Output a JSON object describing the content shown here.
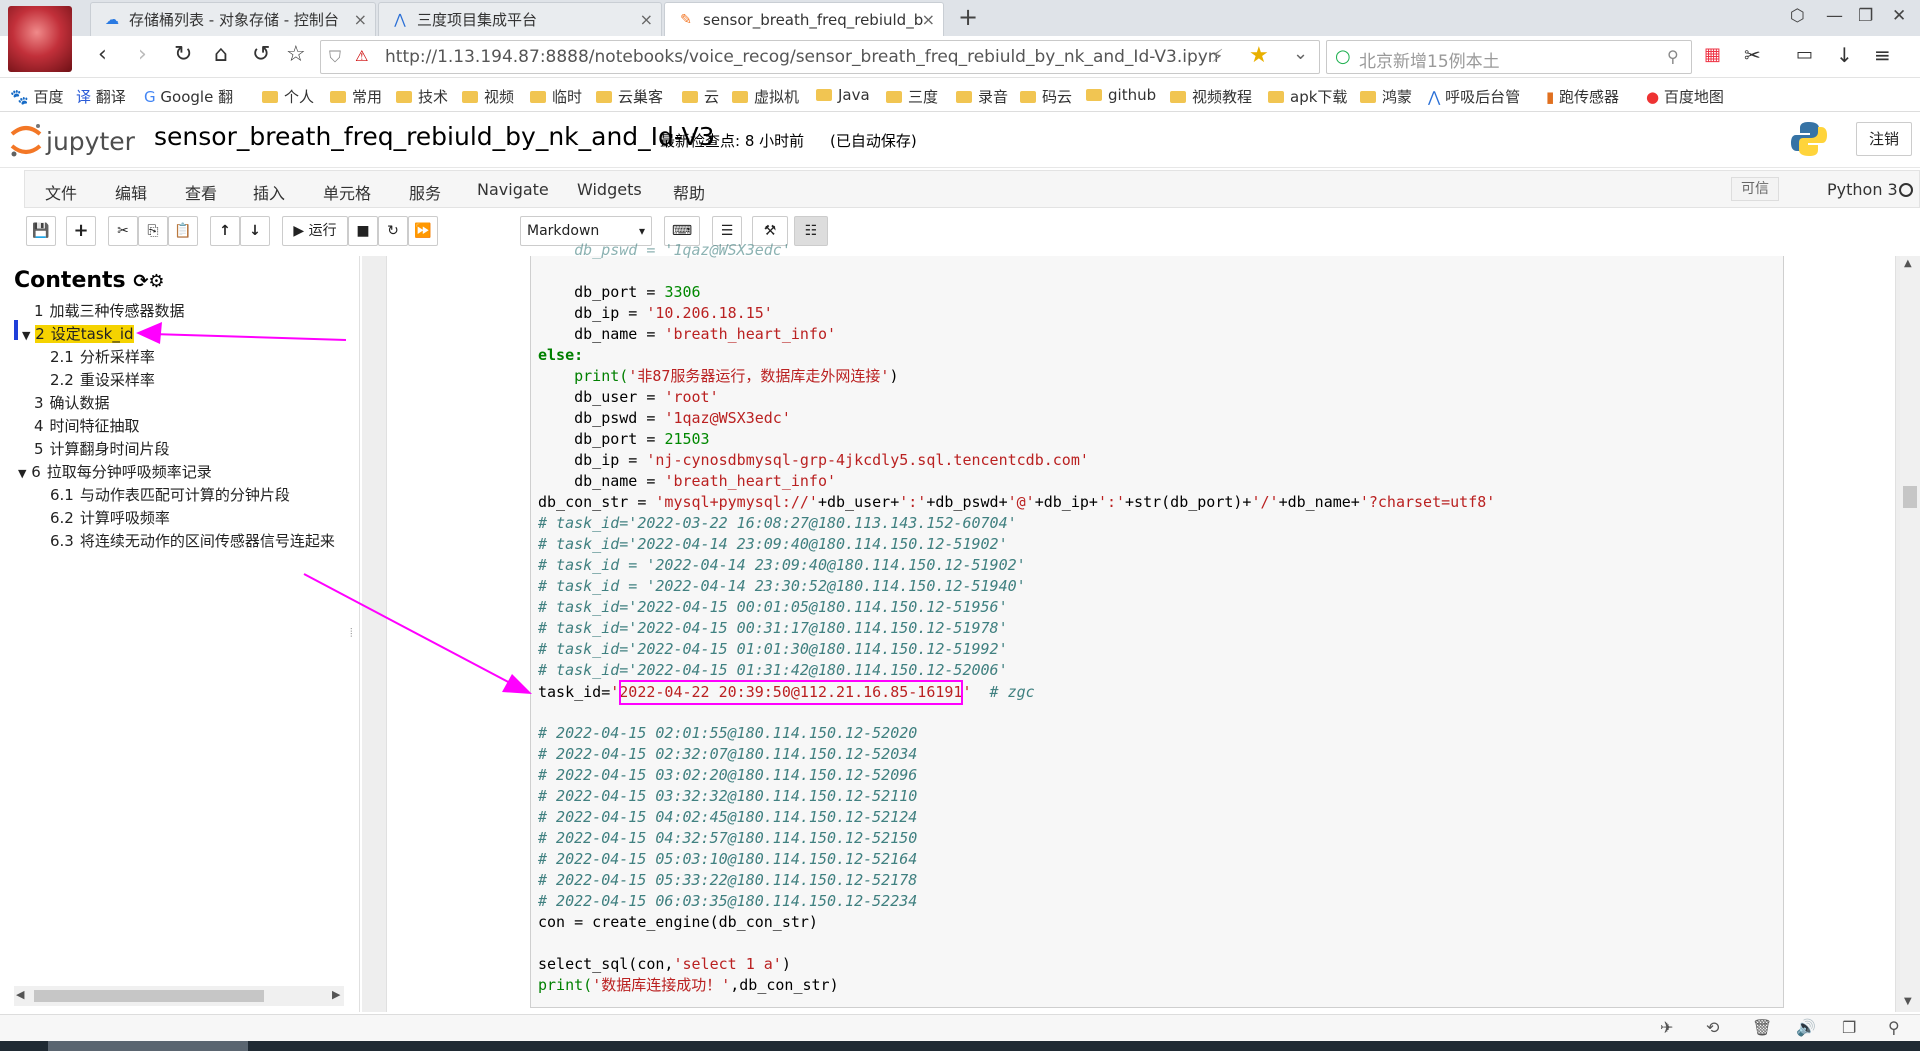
{
  "browser": {
    "tabs": [
      {
        "label": "存储桶列表 - 对象存储 - 控制台",
        "icon": "cloud-icon"
      },
      {
        "label": "三度项目集成平台",
        "icon": "platform-icon"
      },
      {
        "label": "sensor_breath_freq_rebiuld_b",
        "icon": "jupyter-icon"
      }
    ],
    "url": "http://1.13.194.87:8888/notebooks/voice_recog/sensor_breath_freq_rebiuld_by_nk_and_Id-V3.ipyn",
    "search_placeholder": "北京新增15例本土",
    "bookmarks": [
      "百度",
      "翻译",
      "Google 翻",
      "个人",
      "常用",
      "技术",
      "视频",
      "临时",
      "云巢客",
      "云",
      "虚拟机",
      "Java",
      "三度",
      "录音",
      "码云",
      "github",
      "视频教程",
      "apk下载",
      "鸿蒙",
      "呼吸后台管",
      "跑传感器",
      "百度地图"
    ]
  },
  "jupyter": {
    "logo_text": "jupyter",
    "notebook_name": "sensor_breath_freq_rebiuld_by_nk_and_Id-V3",
    "checkpoint": "最新检查点: 8 小时前",
    "autosave": "(已自动保存)",
    "logout": "注销",
    "menu": [
      "文件",
      "编辑",
      "查看",
      "插入",
      "单元格",
      "服务",
      "Navigate",
      "Widgets",
      "帮助"
    ],
    "trusted": "可信",
    "kernel": "Python 3",
    "toolbar": {
      "run": "运行",
      "cell_type": "Markdown"
    }
  },
  "toc": {
    "title": "Contents",
    "items": [
      {
        "num": "1",
        "label": "加载三种传感器数据"
      },
      {
        "num": "2",
        "label": "设定task_id"
      },
      {
        "num": "2.1",
        "label": "分析采样率"
      },
      {
        "num": "2.2",
        "label": "重设采样率"
      },
      {
        "num": "3",
        "label": "确认数据"
      },
      {
        "num": "4",
        "label": "时间特征抽取"
      },
      {
        "num": "5",
        "label": "计算翻身时间片段"
      },
      {
        "num": "6",
        "label": "拉取每分钟呼吸频率记录"
      },
      {
        "num": "6.1",
        "label": "与动作表匹配可计算的分钟片段"
      },
      {
        "num": "6.2",
        "label": "计算呼吸频率"
      },
      {
        "num": "6.3",
        "label": "将连续无动作的区间传感器信号连起来"
      }
    ]
  },
  "code": {
    "l_top": "    db_pswd = '1qaz@WSX3edc'",
    "l1_a": "    db_port = ",
    "l1_b": "3306",
    "l2_a": "    db_ip = ",
    "l2_b": "'10.206.18.15'",
    "l3_a": "    db_name = ",
    "l3_b": "'breath_heart_info'",
    "l4": "else:",
    "l5_a": "    print(",
    "l5_b": "'非87服务器运行，数据库走外网连接'",
    "l5_c": ")",
    "l6_a": "    db_user = ",
    "l6_b": "'root'",
    "l7_a": "    db_pswd = ",
    "l7_b": "'1qaz@WSX3edc'",
    "l8_a": "    db_port = ",
    "l8_b": "21503",
    "l9_a": "    db_ip = ",
    "l9_b": "'nj-cynosdbmysql-grp-4jkcdly5.sql.tencentcdb.com'",
    "l10_a": "    db_name = ",
    "l10_b": "'breath_heart_info'",
    "l11_a": "db_con_str = ",
    "l11_b": "'mysql+pymysql://'",
    "l11_c": "+db_user+",
    "l11_d": "':'",
    "l11_e": "+db_pswd+",
    "l11_f": "'@'",
    "l11_g": "+db_ip+",
    "l11_h": "':'",
    "l11_i": "+str(db_port)+",
    "l11_j": "'/'",
    "l11_k": "+db_name+",
    "l11_l": "'?charset=utf8'",
    "c1": "# task_id='2022-03-22 16:08:27@180.113.143.152-60704'",
    "c2": "# task_id='2022-04-14 23:09:40@180.114.150.12-51902'",
    "c3": "# task_id = '2022-04-14 23:09:40@180.114.150.12-51902'",
    "c4": "# task_id = '2022-04-14 23:30:52@180.114.150.12-51940'",
    "c5": "# task_id='2022-04-15 00:01:05@180.114.150.12-51956'",
    "c6": "# task_id='2022-04-15 00:31:17@180.114.150.12-51978'",
    "c7": "# task_id='2022-04-15 01:01:30@180.114.150.12-51992'",
    "c8": "# task_id='2022-04-15 01:31:42@180.114.150.12-52006'",
    "t_a": "task_id=",
    "t_b": "'2022-04-22 20:39:50@112.21.16.85-16191'",
    "t_c": "  # zgc",
    "d1": "# 2022-04-15 02:01:55@180.114.150.12-52020",
    "d2": "# 2022-04-15 02:32:07@180.114.150.12-52034",
    "d3": "# 2022-04-15 03:02:20@180.114.150.12-52096",
    "d4": "# 2022-04-15 03:32:32@180.114.150.12-52110",
    "d5": "# 2022-04-15 04:02:45@180.114.150.12-52124",
    "d6": "# 2022-04-15 04:32:57@180.114.150.12-52150",
    "d7": "# 2022-04-15 05:03:10@180.114.150.12-52164",
    "d8": "# 2022-04-15 05:33:22@180.114.150.12-52178",
    "d9": "# 2022-04-15 06:03:35@180.114.150.12-52234",
    "e1": "con = create_engine(db_con_str)",
    "e2_a": "select_sql(con,",
    "e2_b": "'select 1 a'",
    "e2_c": ")",
    "e3_a": "print(",
    "e3_b": "'数据库连接成功！'",
    "e3_c": ",db_con_str)"
  },
  "colors": {
    "annotation": "#ff00ff",
    "toc_highlight": "#f5d300",
    "string": "#ba2121",
    "comment": "#408080",
    "keyword": "#008000"
  }
}
